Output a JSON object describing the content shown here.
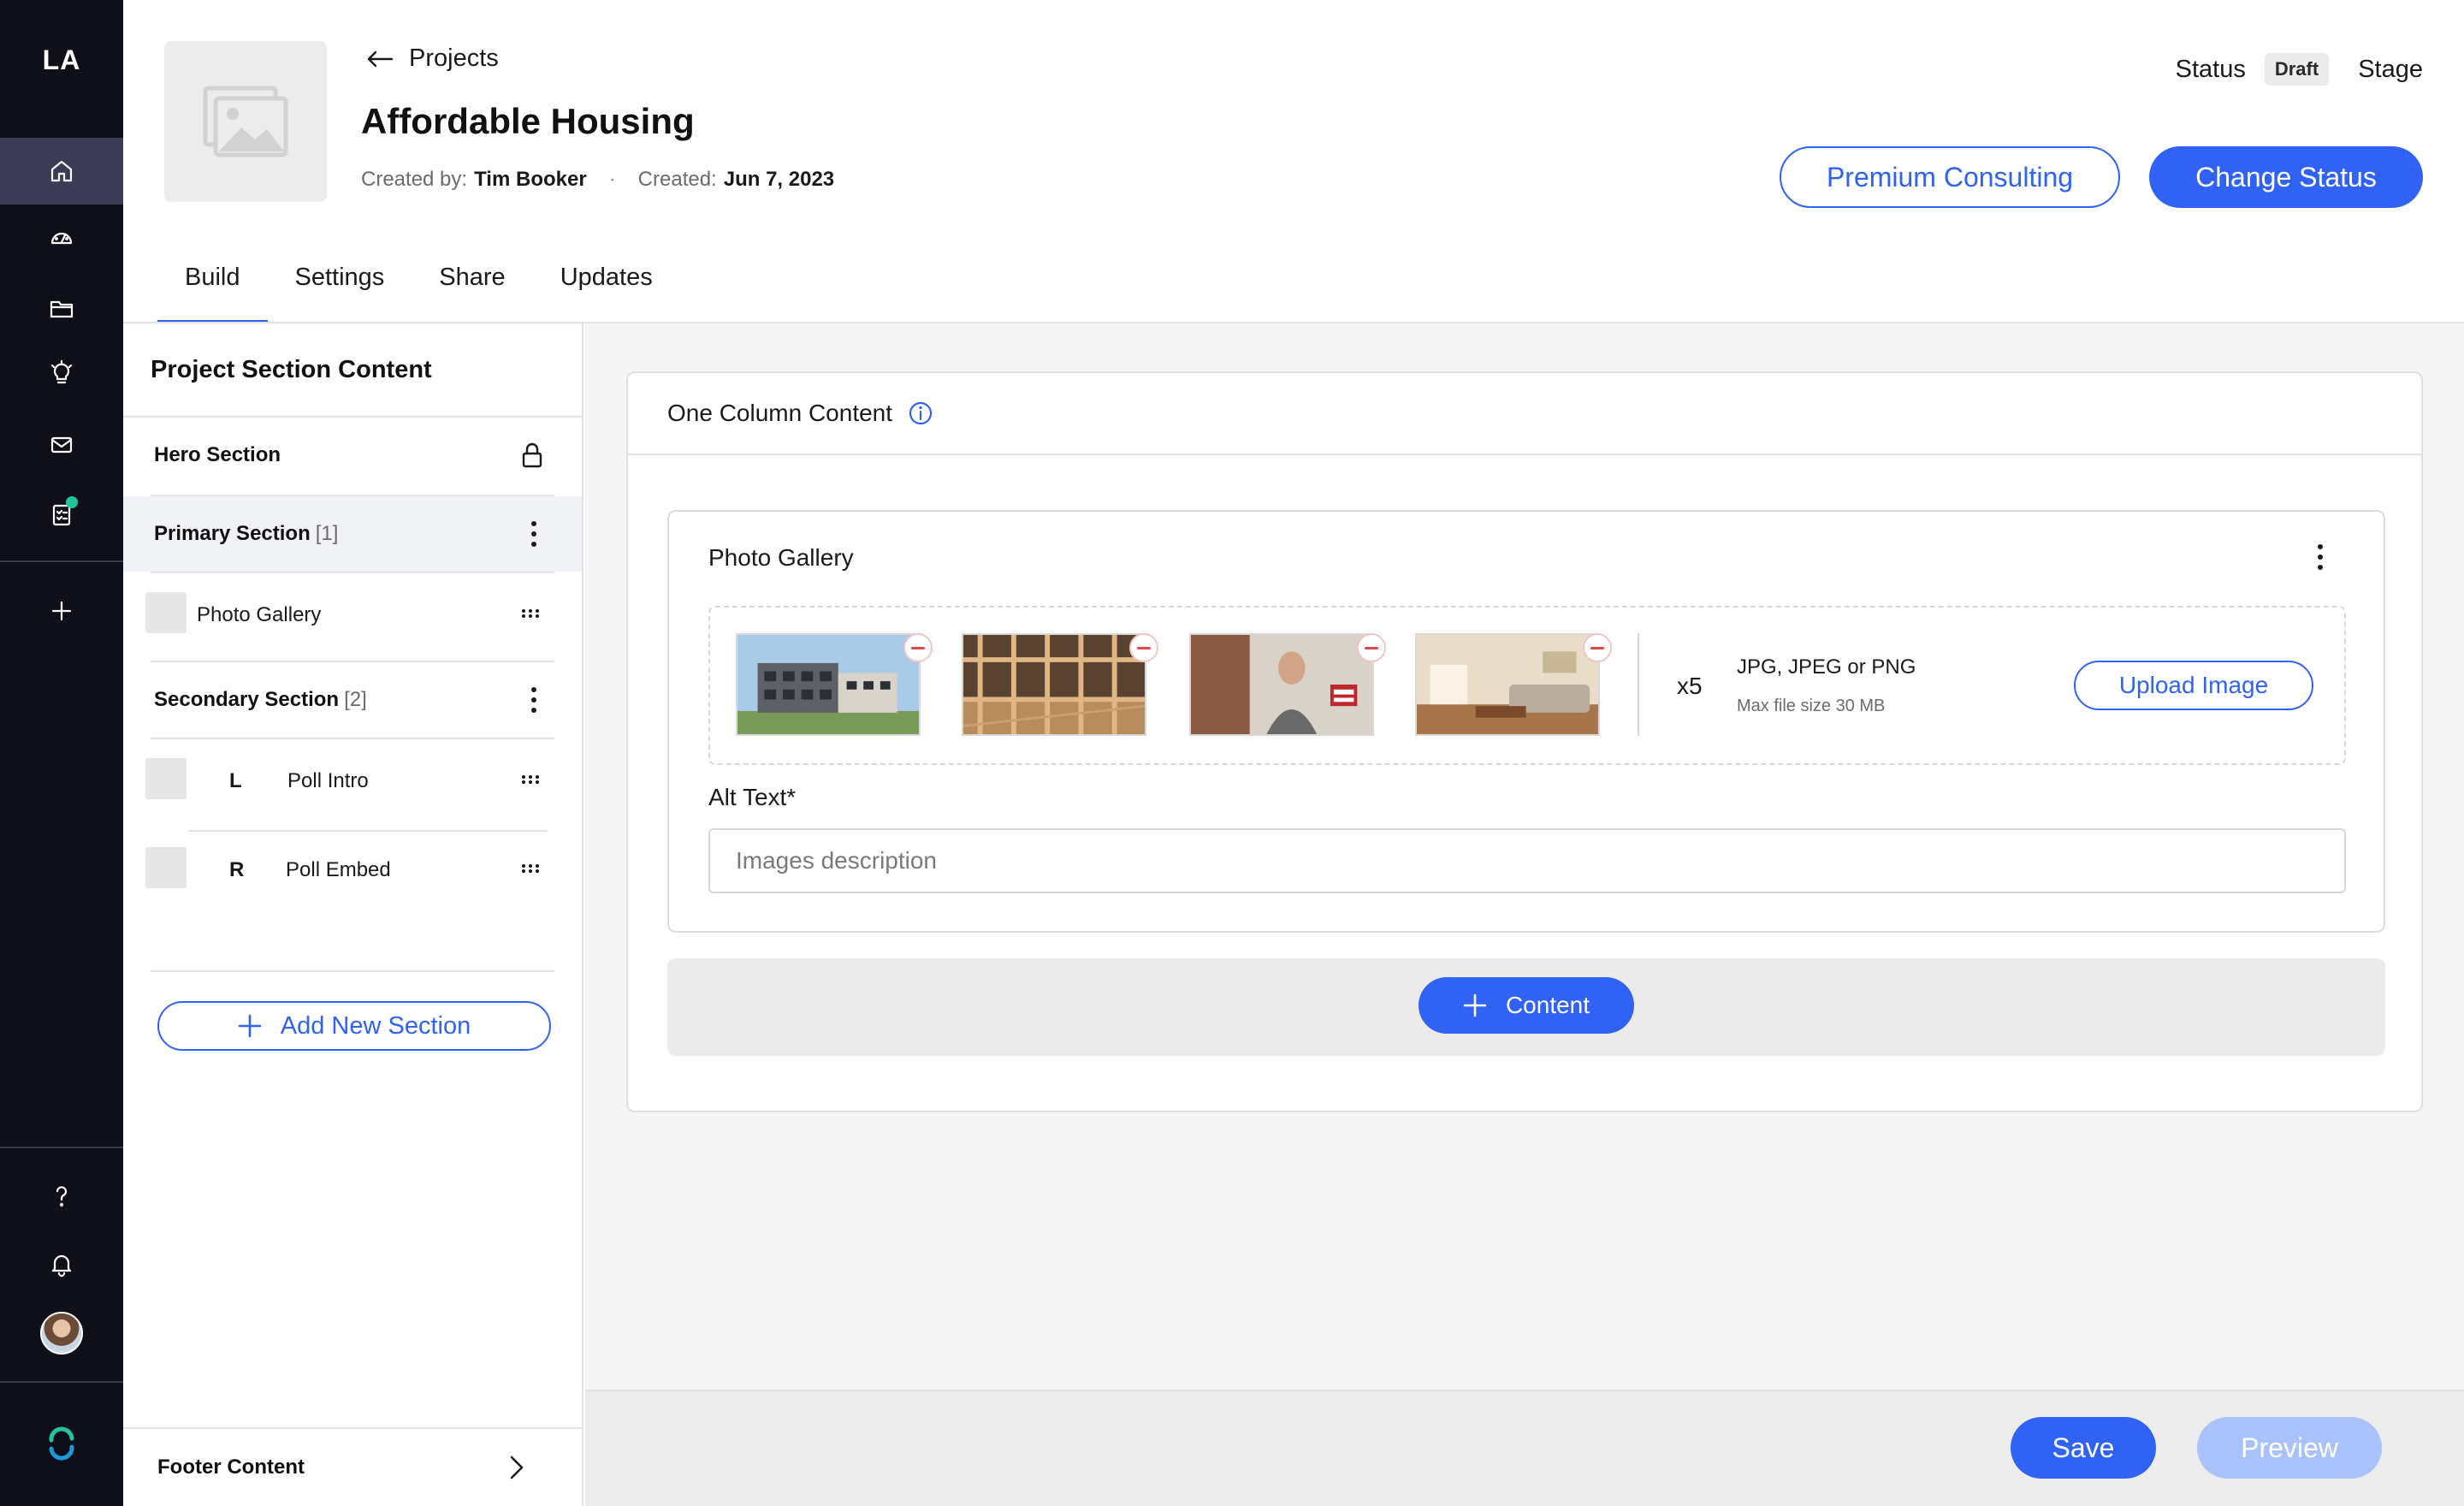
{
  "rail": {
    "logo": "LA",
    "icons": [
      "home-icon",
      "dashboard-icon",
      "folder-icon",
      "lightbulb-icon",
      "mail-icon",
      "clipboard-icon",
      "plus-icon",
      "help-icon",
      "bell-icon",
      "avatar",
      "brand-logo"
    ],
    "notification_color": "#22c59a"
  },
  "header": {
    "back_label": "Projects",
    "title": "Affordable Housing",
    "created_by_label": "Created by:",
    "created_by": "Tim Booker",
    "bullet": "·",
    "created_label": "Created:",
    "created_date": "Jun 7, 2023",
    "status_label": "Status",
    "status_value": "Draft",
    "stage_label": "Stage",
    "premium_button": "Premium Consulting",
    "change_status_button": "Change Status"
  },
  "tabs": [
    {
      "label": "Build",
      "active": true
    },
    {
      "label": "Settings",
      "active": false
    },
    {
      "label": "Share",
      "active": false
    },
    {
      "label": "Updates",
      "active": false
    }
  ],
  "sidebar": {
    "title": "Project Section Content",
    "hero": "Hero Section",
    "primary": {
      "label": "Primary Section",
      "count": "[1]"
    },
    "primary_items": [
      {
        "label": "Photo Gallery"
      }
    ],
    "secondary": {
      "label": "Secondary Section",
      "count": "[2]"
    },
    "secondary_items": [
      {
        "side": "L",
        "label": "Poll Intro"
      },
      {
        "side": "R",
        "label": "Poll Embed"
      }
    ],
    "add_button": "Add New Section",
    "footer": "Footer Content"
  },
  "main": {
    "card_title": "One Column Content",
    "gallery_title": "Photo Gallery",
    "photo_count": "x5",
    "formats": "JPG, JPEG or PNG",
    "max_size": "Max file size 30 MB",
    "upload_button": "Upload Image",
    "alt_label": "Alt Text*",
    "alt_placeholder": "Images description",
    "content_button": "Content"
  },
  "footer": {
    "save_button": "Save",
    "preview_button": "Preview"
  },
  "colors": {
    "accent": "#2f62f5",
    "rail_bg": "#0f0f19",
    "accent_disabled": "#a9c2fb",
    "remove": "#e04848"
  }
}
